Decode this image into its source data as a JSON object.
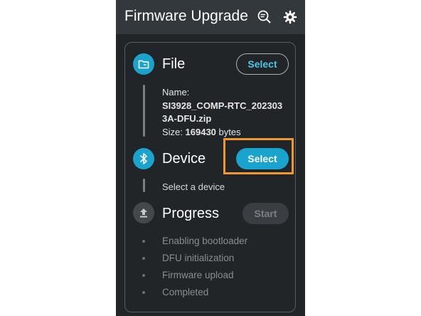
{
  "app_bar": {
    "title": "Firmware Upgrade",
    "icons": [
      "search-list-icon",
      "gear-icon"
    ]
  },
  "file_step": {
    "title": "File",
    "icon": "folder-icon",
    "button_label": "Select",
    "name_label": "Name:",
    "file_name_line1": "SI3928_COMP-RTC_202303",
    "file_name_line2": "3A-DFU.zip",
    "size_label": "Size:",
    "size_value": "169430",
    "size_unit": "bytes"
  },
  "device_step": {
    "title": "Device",
    "icon": "bluetooth-icon",
    "button_label": "Select",
    "status": "Select a device"
  },
  "progress_step": {
    "title": "Progress",
    "icon": "upload-icon",
    "button_label": "Start",
    "items": [
      "Enabling bootloader",
      "DFU initialization",
      "Firmware upload",
      "Completed"
    ]
  },
  "colors": {
    "accent": "#1aa3cc",
    "background": "#222528",
    "app_bar": "#33383d",
    "highlight": "#f0962e"
  }
}
